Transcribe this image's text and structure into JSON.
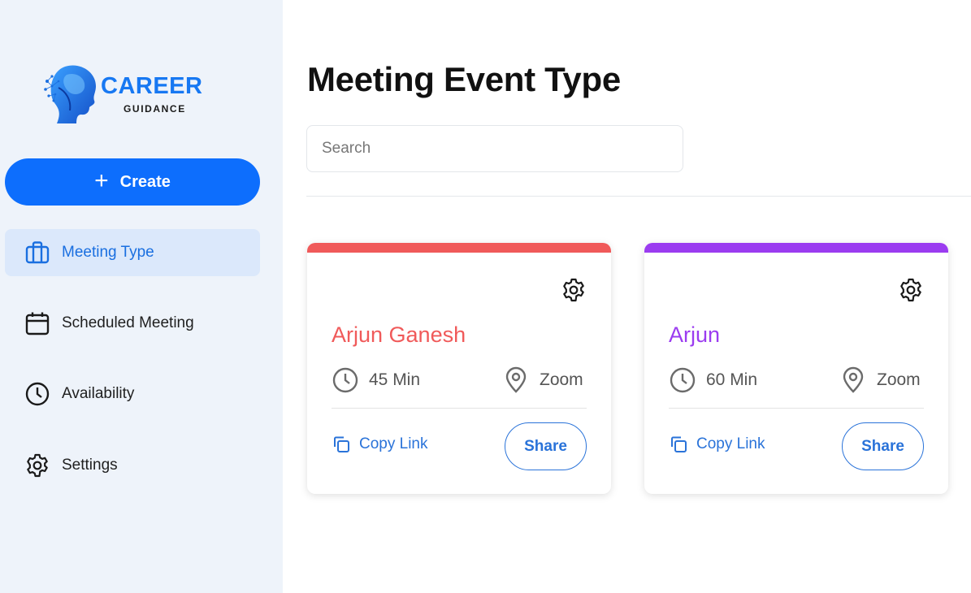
{
  "logo": {
    "brand": "CAREER",
    "sub": "GUIDANCE"
  },
  "sidebar": {
    "create_label": "Create",
    "items": [
      {
        "label": "Meeting Type",
        "icon": "briefcase-icon",
        "active": true
      },
      {
        "label": "Scheduled Meeting",
        "icon": "calendar-icon",
        "active": false
      },
      {
        "label": "Availability",
        "icon": "clock-icon",
        "active": false
      },
      {
        "label": "Settings",
        "icon": "gear-icon",
        "active": false
      }
    ]
  },
  "main": {
    "title": "Meeting Event Type",
    "search_placeholder": "Search",
    "cards": [
      {
        "name": "Arjun Ganesh",
        "duration": "45 Min",
        "location": "Zoom",
        "copy_label": "Copy Link",
        "share_label": "Share",
        "accent": "#f05a5a"
      },
      {
        "name": "Arjun",
        "duration": "60 Min",
        "location": "Zoom",
        "copy_label": "Copy Link",
        "share_label": "Share",
        "accent": "#9b3cf0"
      }
    ]
  },
  "colors": {
    "primary": "#0d6efd",
    "link": "#2a73d9",
    "sidebar_bg": "#eef3fa",
    "active_bg": "#dbe8fb"
  }
}
